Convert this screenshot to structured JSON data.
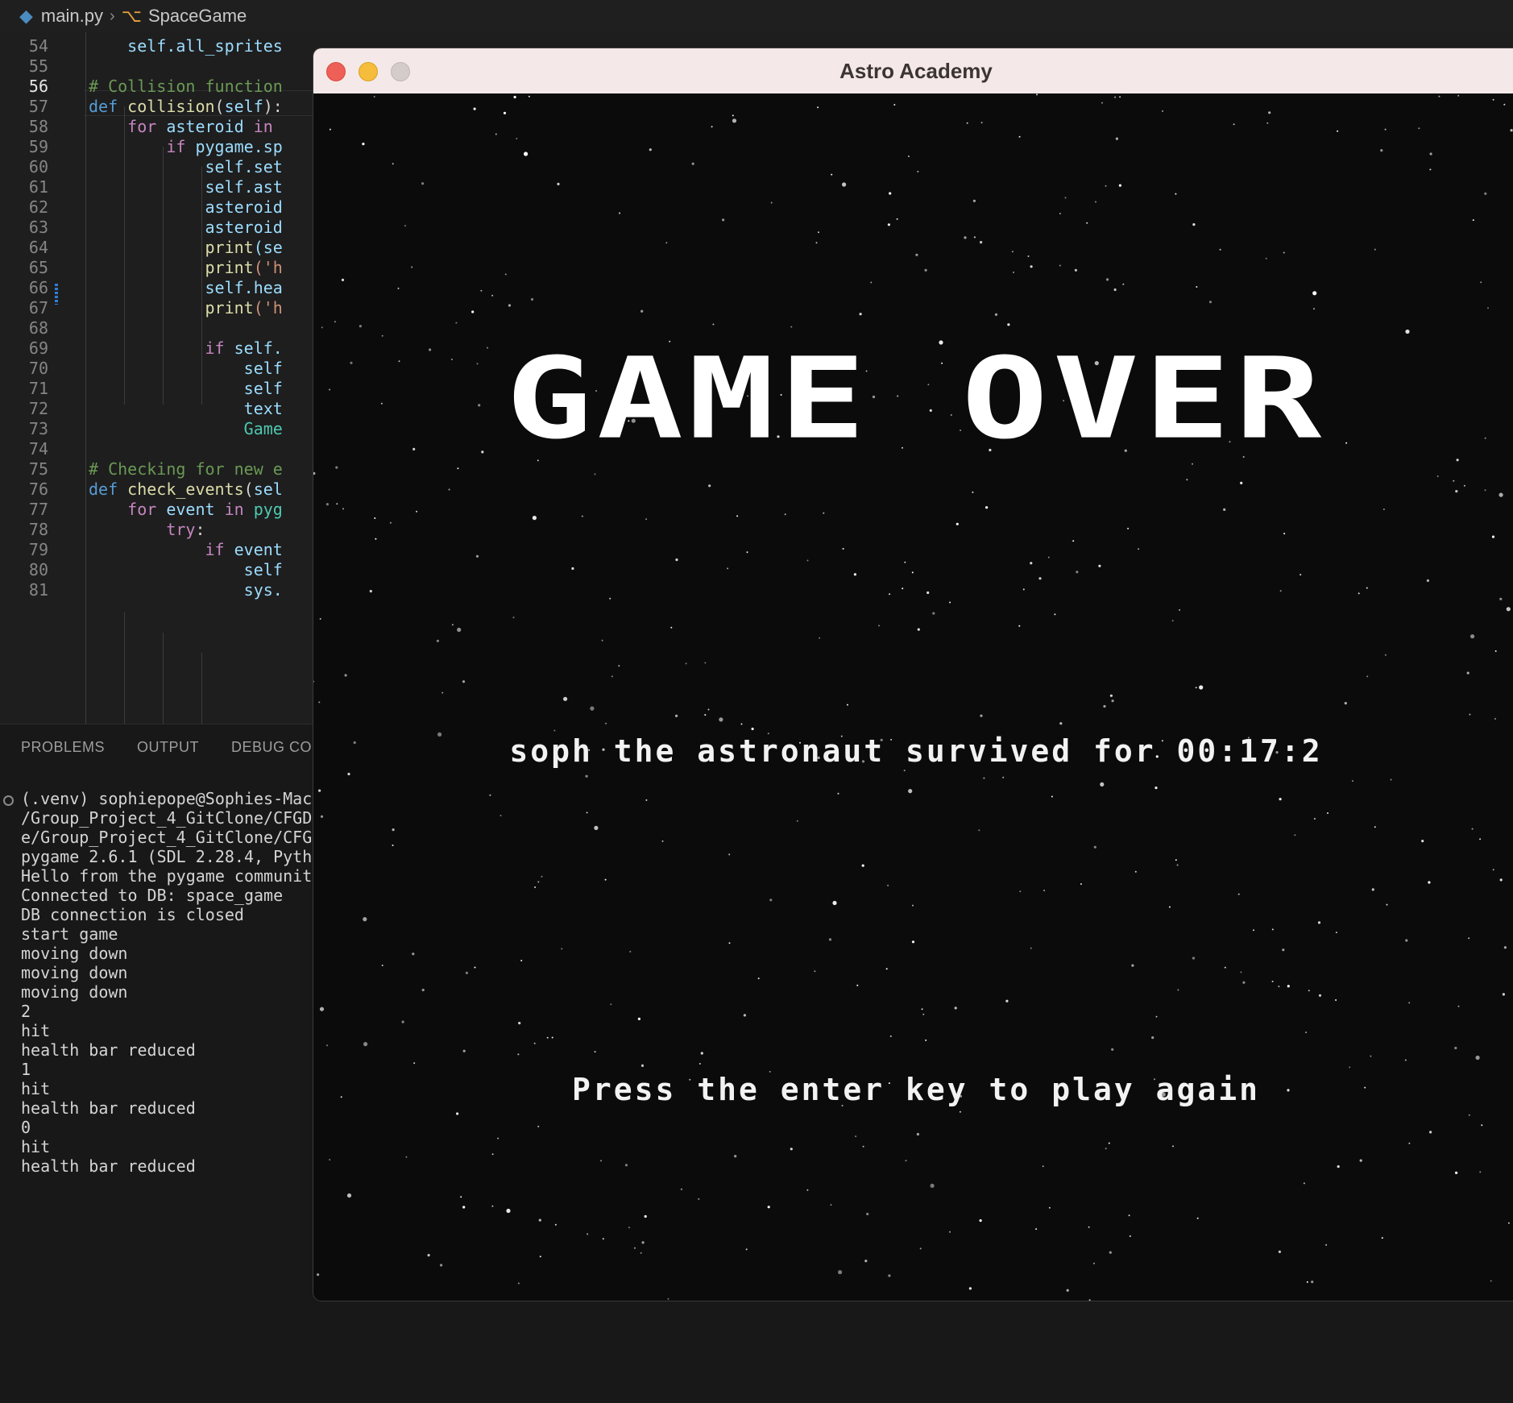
{
  "breadcrumb": {
    "file": "main.py",
    "symbol": "SpaceGame"
  },
  "editor": {
    "active_line": "56",
    "lines": [
      {
        "n": "54",
        "parts": [
          [
            "    self.all_sprites",
            "v"
          ]
        ]
      },
      {
        "n": "55",
        "parts": []
      },
      {
        "n": "56",
        "parts": [
          [
            "# Collision function",
            "c"
          ]
        ]
      },
      {
        "n": "57",
        "parts": [
          [
            "def ",
            "kd"
          ],
          [
            "collision",
            "f"
          ],
          [
            "(",
            "p"
          ],
          [
            "self",
            "v"
          ],
          [
            "):",
            "p"
          ]
        ]
      },
      {
        "n": "58",
        "parts": [
          [
            "    for ",
            "k"
          ],
          [
            "asteroid ",
            "v"
          ],
          [
            "in",
            "k"
          ]
        ]
      },
      {
        "n": "59",
        "parts": [
          [
            "        if ",
            "k"
          ],
          [
            "pygame",
            "v"
          ],
          [
            ".sp",
            "v"
          ]
        ]
      },
      {
        "n": "60",
        "parts": [
          [
            "            self",
            "v"
          ],
          [
            ".set",
            "v"
          ]
        ]
      },
      {
        "n": "61",
        "parts": [
          [
            "            self",
            "v"
          ],
          [
            ".ast",
            "v"
          ]
        ]
      },
      {
        "n": "62",
        "parts": [
          [
            "            asteroid",
            "v"
          ]
        ]
      },
      {
        "n": "63",
        "parts": [
          [
            "            asteroid",
            "v"
          ]
        ]
      },
      {
        "n": "64",
        "parts": [
          [
            "            print",
            "f"
          ],
          [
            "(se",
            "v"
          ]
        ]
      },
      {
        "n": "65",
        "parts": [
          [
            "            print",
            "f"
          ],
          [
            "('h",
            "s"
          ]
        ]
      },
      {
        "n": "66",
        "parts": [
          [
            "            self",
            "v"
          ],
          [
            ".hea",
            "v"
          ]
        ]
      },
      {
        "n": "67",
        "parts": [
          [
            "            print",
            "f"
          ],
          [
            "('h",
            "s"
          ]
        ]
      },
      {
        "n": "68",
        "parts": []
      },
      {
        "n": "69",
        "parts": [
          [
            "            if ",
            "k"
          ],
          [
            "self.",
            "v"
          ]
        ]
      },
      {
        "n": "70",
        "parts": [
          [
            "                self",
            "v"
          ]
        ]
      },
      {
        "n": "71",
        "parts": [
          [
            "                self",
            "v"
          ]
        ]
      },
      {
        "n": "72",
        "parts": [
          [
            "                text",
            "v"
          ]
        ]
      },
      {
        "n": "73",
        "parts": [
          [
            "                Game",
            "t"
          ]
        ]
      },
      {
        "n": "74",
        "parts": []
      },
      {
        "n": "75",
        "parts": [
          [
            "# Checking for new e",
            "c"
          ]
        ]
      },
      {
        "n": "76",
        "parts": [
          [
            "def ",
            "kd"
          ],
          [
            "check_events",
            "f"
          ],
          [
            "(",
            "p"
          ],
          [
            "sel",
            "v"
          ]
        ]
      },
      {
        "n": "77",
        "parts": [
          [
            "    for ",
            "k"
          ],
          [
            "event ",
            "v"
          ],
          [
            "in ",
            "k"
          ],
          [
            "pyg",
            "t"
          ]
        ]
      },
      {
        "n": "78",
        "parts": [
          [
            "        try",
            "k"
          ],
          [
            ":",
            "p"
          ]
        ]
      },
      {
        "n": "79",
        "parts": [
          [
            "            if ",
            "k"
          ],
          [
            "event",
            "v"
          ]
        ]
      },
      {
        "n": "80",
        "parts": [
          [
            "                self",
            "v"
          ]
        ]
      },
      {
        "n": "81",
        "parts": [
          [
            "                sys.",
            "v"
          ]
        ]
      }
    ]
  },
  "panel": {
    "tabs": [
      "PROBLEMS",
      "OUTPUT",
      "DEBUG CON"
    ],
    "terminal_lines": [
      "(.venv) sophiepope@Sophies-Mac",
      "/Group_Project_4_GitClone/CFGD",
      "e/Group_Project_4_GitClone/CFG",
      "pygame 2.6.1 (SDL 2.28.4, Pyth",
      "Hello from the pygame communit",
      "Connected to DB: space_game",
      "DB connection is closed",
      "start game",
      "moving down",
      "moving down",
      "moving down",
      "2",
      "hit",
      "health bar reduced",
      "1",
      "hit",
      "health bar reduced",
      "0",
      "hit",
      "health bar reduced"
    ]
  },
  "game_window": {
    "title": "Astro Academy",
    "headline": "GAME OVER",
    "survived_text": "soph the astronaut survived for 00:17:2",
    "prompt_text": "Press the enter key to play again"
  },
  "colors": {
    "editor_bg": "#1e1e1e",
    "panel_bg": "#181818",
    "titlebar_bg": "#f4e9e8",
    "game_bg": "#0b0b0b",
    "close": "#ee5f57",
    "minimize": "#f5bd3b",
    "zoom_disabled": "#d3cccb"
  }
}
